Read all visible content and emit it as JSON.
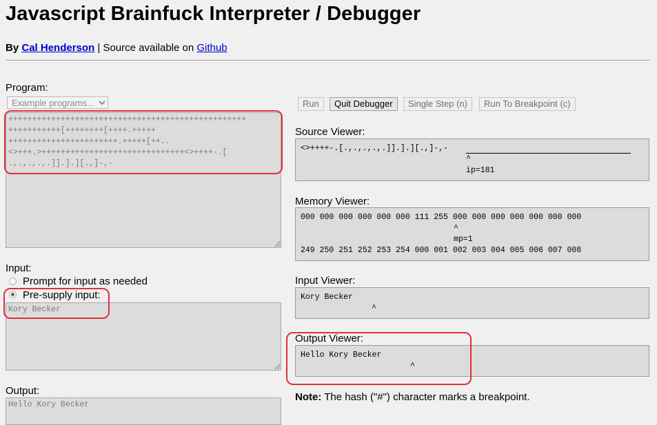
{
  "header": {
    "title": "Javascript Brainfuck Interpreter / Debugger",
    "by": "By",
    "author": "Cal Henderson",
    "sep": "| Source available on",
    "source_link": "Github"
  },
  "program": {
    "label": "Program:",
    "example_placeholder": "Example programs...",
    "code_lines": [
      "++++++++++++++++++++++++++++++++++++++++++++++++++",
      "+++++++++++[++++++++[++++.+++++",
      "+++++++++++++++++++++++.+++++[++..",
      "<>+++.>++++++++++++++++++++++++++++++<>++++-.[",
      ".,.,.,.,.]].].][.,]-,-"
    ]
  },
  "input": {
    "label": "Input:",
    "option_prompt": "Prompt for input as needed",
    "option_presupply": "Pre-supply input:",
    "selected": "presupply",
    "value": "Kory Becker"
  },
  "output": {
    "label": "Output:",
    "value": "Hello Kory Becker"
  },
  "toolbar": {
    "run": "Run",
    "quit_debugger": "Quit Debugger",
    "single_step": "Single Step (n)",
    "run_to_breakpoint": "Run To Breakpoint (c)"
  },
  "source_viewer": {
    "label": "Source Viewer:",
    "code": "<>++++-.[.,.,.,.,.]].].][.,]-,-",
    "caret": "^",
    "ip": "ip=181"
  },
  "memory_viewer": {
    "label": "Memory Viewer:",
    "values": "000 000 000 000 000 000 111 255 000 000 000 000 000 000 000",
    "caret": "^",
    "mp": "mp=1",
    "indices": "249 250 251 252 253 254 000 001 002 003 004 005 006 007 008"
  },
  "input_viewer": {
    "label": "Input Viewer:",
    "value": "Kory Becker",
    "caret": "^"
  },
  "output_viewer": {
    "label": "Output Viewer:",
    "value": "Hello Kory Becker",
    "caret": "^"
  },
  "note": {
    "label": "Note:",
    "text": "The hash (\"#\") character marks a breakpoint."
  },
  "colors": {
    "link": "#0000cc",
    "callout": "#e0303a",
    "panel_bg": "#dcdcdc"
  }
}
